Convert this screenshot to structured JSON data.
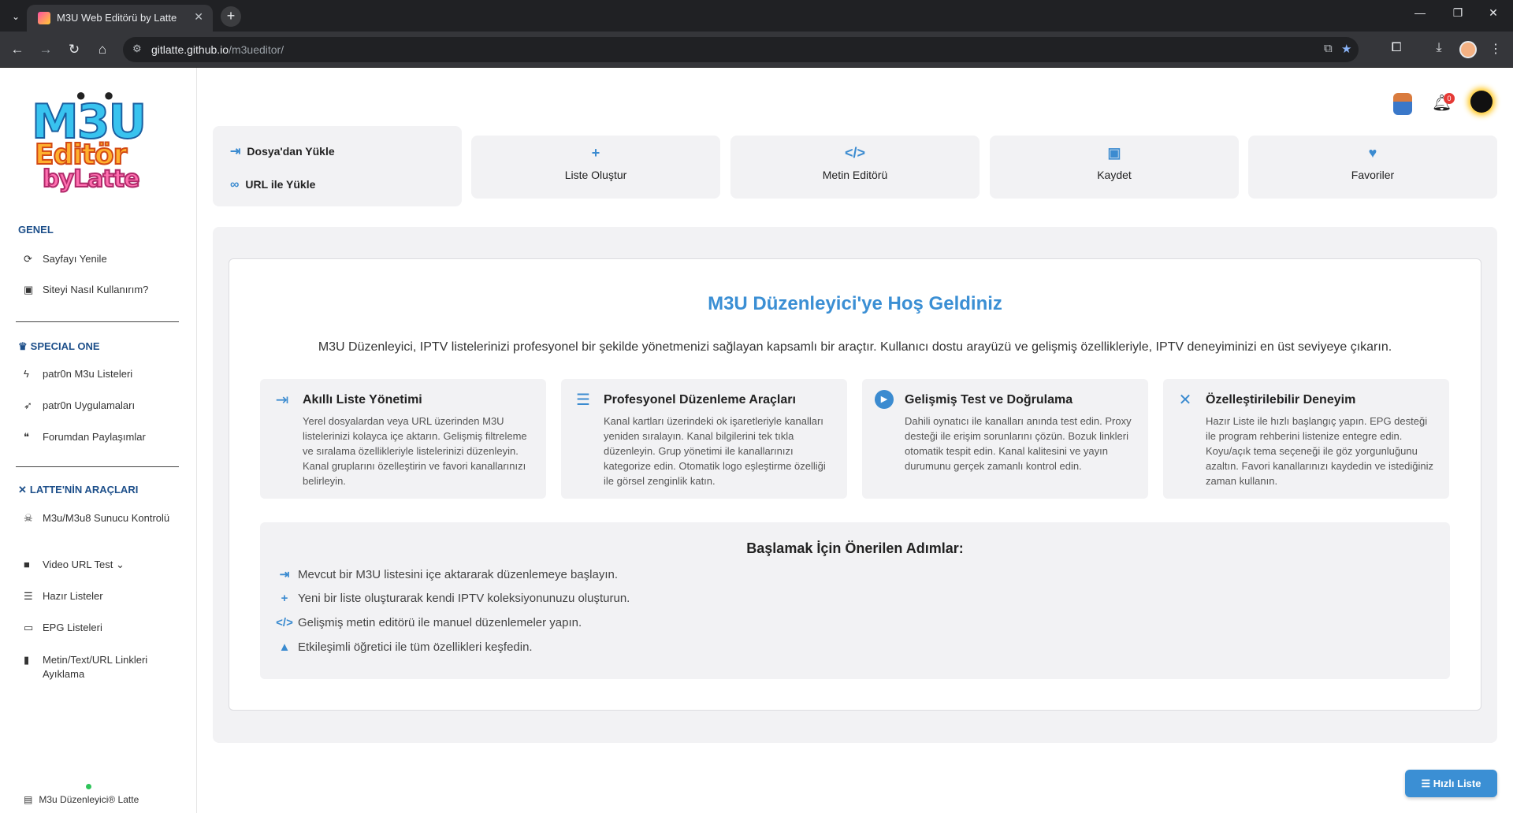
{
  "browser": {
    "tab_title": "M3U Web Editörü by Latte",
    "url_host": "gitlatte.github.io",
    "url_path": "/m3ueditor/"
  },
  "logo": {
    "line1": "M3U",
    "line2": "Editör",
    "line3": "byLatte"
  },
  "sidebar": {
    "sections": {
      "genel": "GENEL",
      "special": "SPECIAL ONE",
      "tools": "LATTE'NİN ARAÇLARI"
    },
    "genel_items": [
      {
        "label": "Sayfayı Yenile",
        "icon": "refresh-icon"
      },
      {
        "label": "Siteyi Nasıl Kullanırım?",
        "icon": "help-icon"
      }
    ],
    "special_items": [
      {
        "label": "patr0n M3u Listeleri",
        "icon": "bolt-icon"
      },
      {
        "label": "patr0n Uygulamaları",
        "icon": "rocket-icon"
      },
      {
        "label": "Forumdan Paylaşımlar",
        "icon": "comments-icon"
      }
    ],
    "tool_items": [
      {
        "label": "M3u/M3u8 Sunucu Kontrolü",
        "icon": "skull-icon"
      },
      {
        "label": "Video URL Test",
        "icon": "video-icon"
      },
      {
        "label": "Hazır Listeler",
        "icon": "list-icon"
      },
      {
        "label": "EPG Listeleri",
        "icon": "monitor-icon"
      },
      {
        "label": "Metin/Text/URL Linkleri Ayıklama",
        "icon": "file-icon"
      }
    ],
    "footer": "M3u Düzenleyici® Latte"
  },
  "header": {
    "notification_count": "0"
  },
  "actions": {
    "load_file": "Dosya'dan Yükle",
    "load_url": "URL ile Yükle",
    "buttons": [
      {
        "label": "Liste Oluştur",
        "icon": "plus-icon"
      },
      {
        "label": "Metin Editörü",
        "icon": "code-icon"
      },
      {
        "label": "Kaydet",
        "icon": "save-icon"
      },
      {
        "label": "Favoriler",
        "icon": "heart-icon"
      }
    ]
  },
  "welcome": {
    "title": "M3U Düzenleyici'ye Hoş Geldiniz",
    "description": "M3U Düzenleyici, IPTV listelerinizi profesyonel bir şekilde yönetmenizi sağlayan kapsamlı bir araçtır. Kullanıcı dostu arayüzü ve gelişmiş özellikleriyle, IPTV deneyiminizi en üst seviyeye çıkarın.",
    "features": [
      {
        "title": "Akıllı Liste Yönetimi",
        "text": "Yerel dosyalardan veya URL üzerinden M3U listelerinizi kolayca içe aktarın. Gelişmiş filtreleme ve sıralama özellikleriyle listelerinizi düzenleyin. Kanal gruplarını özelleştirin ve favori kanallarınızı belirleyin."
      },
      {
        "title": "Profesyonel Düzenleme Araçları",
        "text": "Kanal kartları üzerindeki ok işaretleriyle kanalları yeniden sıralayın. Kanal bilgilerini tek tıkla düzenleyin. Grup yönetimi ile kanallarınızı kategorize edin. Otomatik logo eşleştirme özelliği ile görsel zenginlik katın."
      },
      {
        "title": "Gelişmiş Test ve Doğrulama",
        "text": "Dahili oynatıcı ile kanalları anında test edin. Proxy desteği ile erişim sorunlarını çözün. Bozuk linkleri otomatik tespit edin. Kanal kalitesini ve yayın durumunu gerçek zamanlı kontrol edin."
      },
      {
        "title": "Özelleştirilebilir Deneyim",
        "text": "Hazır Liste ile hızlı başlangıç yapın. EPG desteği ile program rehberini listenize entegre edin. Koyu/açık tema seçeneği ile göz yorgunluğunu azaltın. Favori kanallarınızı kaydedin ve istediğiniz zaman kullanın."
      }
    ],
    "steps_title": "Başlamak İçin Önerilen Adımlar:",
    "steps": [
      "Mevcut bir M3U listesini içe aktararak düzenlemeye başlayın.",
      "Yeni bir liste oluşturarak kendi IPTV koleksiyonunuzu oluşturun.",
      "Gelişmiş metin editörü ile manuel düzenlemeler yapın.",
      "Etkileşimli öğretici ile tüm özellikleri keşfedin."
    ]
  },
  "quick_list": "Hızlı Liste",
  "colors": {
    "accent": "#3b8fd4",
    "heading": "#1d4f8a",
    "panel": "#f2f2f4"
  }
}
